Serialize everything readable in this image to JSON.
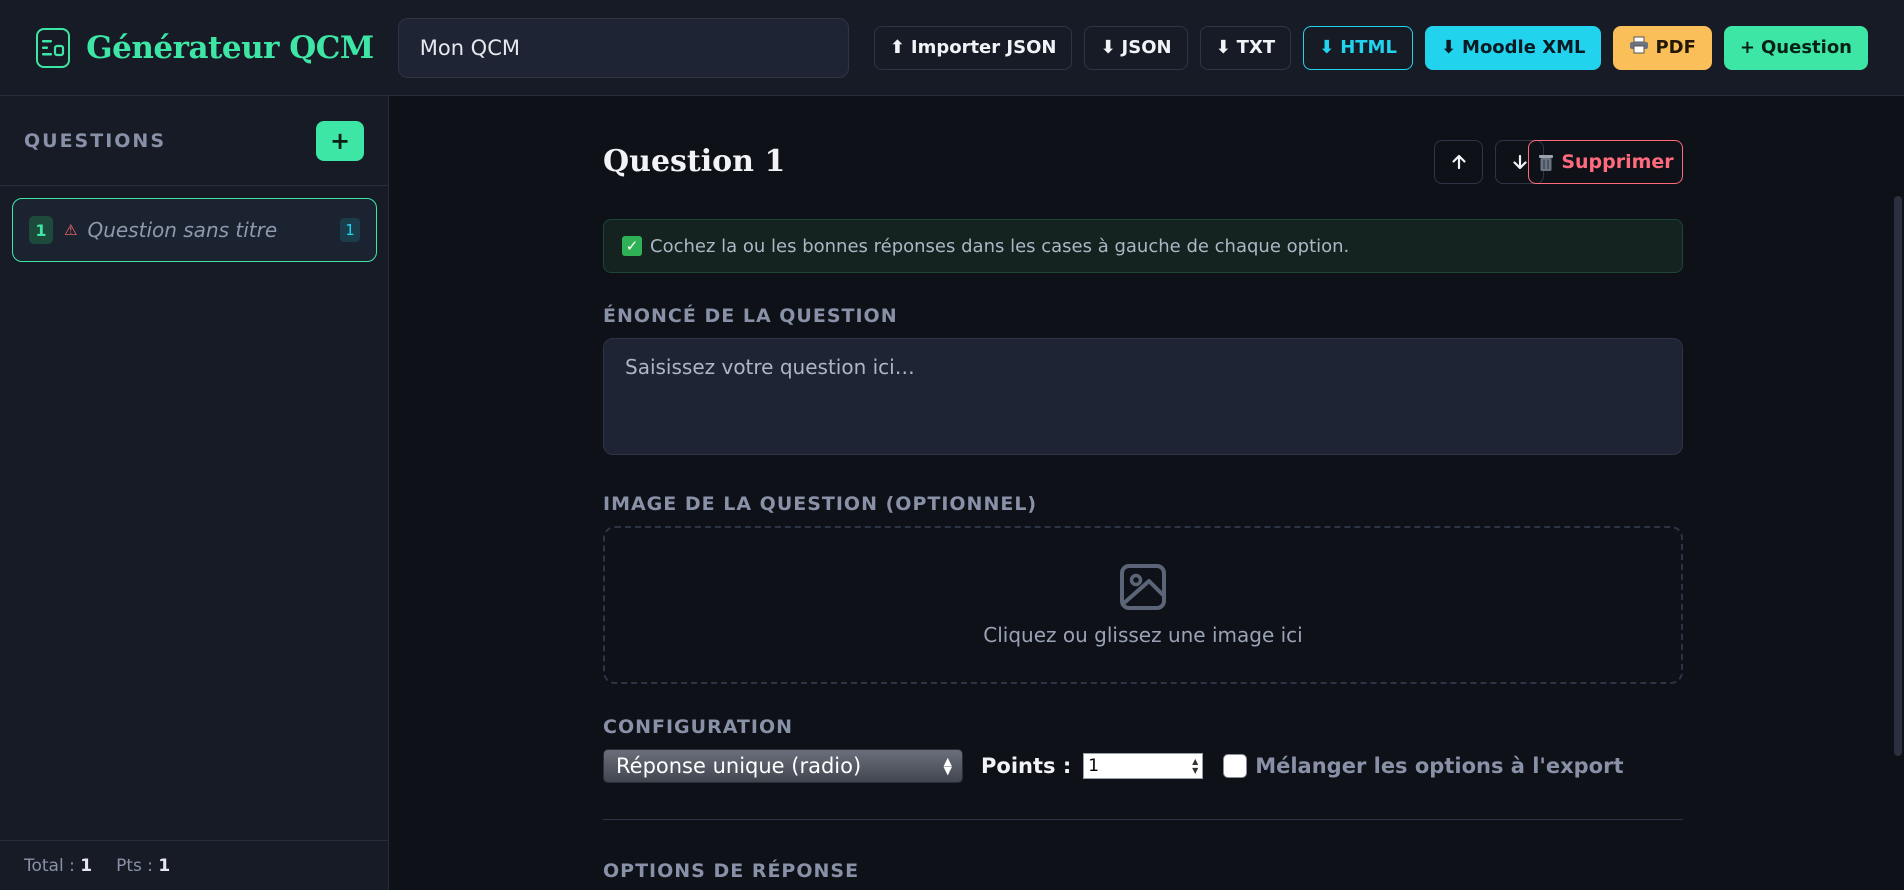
{
  "header": {
    "app_title": "Générateur QCM",
    "qcm_title_value": "Mon QCM",
    "buttons": {
      "import_json": "Importer JSON",
      "export_json": "JSON",
      "export_txt": "TXT",
      "export_html": "HTML",
      "export_moodle": "Moodle XML",
      "export_pdf": "PDF",
      "add_question": "Question"
    }
  },
  "sidebar": {
    "title": "QUESTIONS",
    "add_label": "+",
    "items": [
      {
        "number": "1",
        "label": "Question sans titre",
        "points": "1"
      }
    ],
    "footer": {
      "total_label": "Total :",
      "total_value": "1",
      "pts_label": "Pts :",
      "pts_value": "1"
    }
  },
  "editor": {
    "question_title": "Question 1",
    "delete_label": "Supprimer",
    "tip_text": "Cochez la ou les bonnes réponses dans les cases à gauche de chaque option.",
    "statement_label": "ÉNONCÉ DE LA QUESTION",
    "statement_placeholder": "Saisissez votre question ici…",
    "image_label": "IMAGE DE LA QUESTION (OPTIONNEL)",
    "dropzone_text": "Cliquez ou glissez une image ici",
    "config_label": "CONFIGURATION",
    "answer_type_selected": "Réponse unique (radio)",
    "points_label": "Points :",
    "points_value": "1",
    "shuffle_label": "Mélanger les options à l'export",
    "shuffle_checked": false,
    "options_label": "OPTIONS DE RÉPONSE"
  },
  "colors": {
    "accent_green": "#3ee6a5",
    "accent_cyan": "#22d3ee",
    "accent_yellow": "#fbbf5a",
    "danger_red": "#ff6b7d",
    "background": "#0e1117",
    "panel": "#161b26"
  }
}
